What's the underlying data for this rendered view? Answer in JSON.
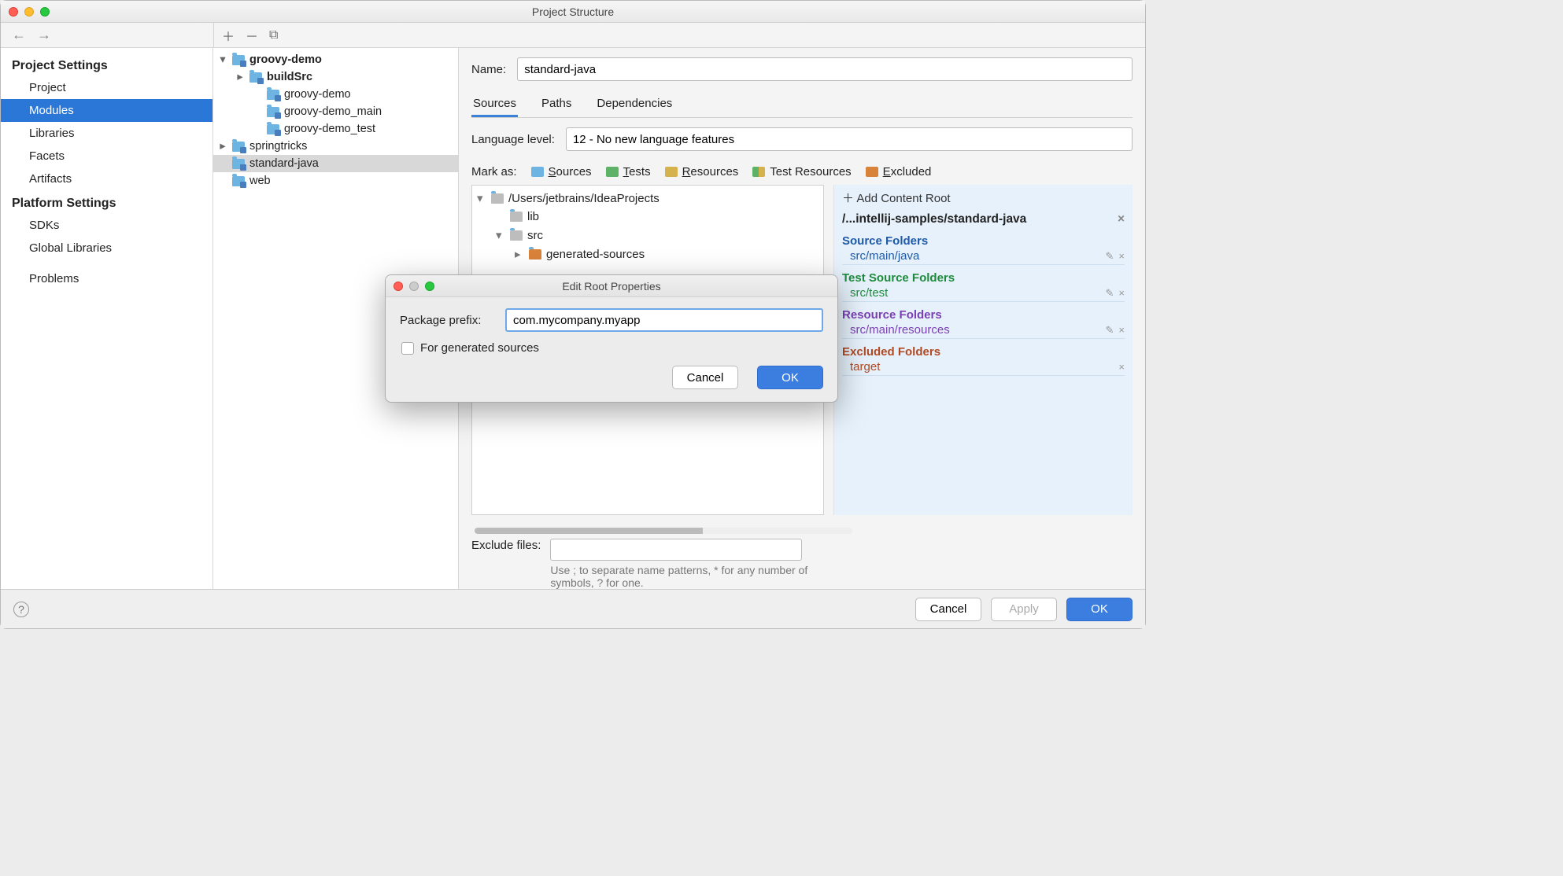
{
  "window": {
    "title": "Project Structure"
  },
  "sidebar": {
    "heading1": "Project Settings",
    "heading2": "Platform Settings",
    "items1": [
      "Project",
      "Modules",
      "Libraries",
      "Facets",
      "Artifacts"
    ],
    "items2": [
      "SDKs",
      "Global Libraries"
    ],
    "problems": "Problems",
    "selected": "Modules"
  },
  "tree": [
    {
      "indent": 0,
      "arrow": "down",
      "bold": true,
      "label": "groovy-demo",
      "mod": true
    },
    {
      "indent": 1,
      "arrow": "right",
      "bold": true,
      "label": "buildSrc",
      "mod": true
    },
    {
      "indent": 2,
      "arrow": "none",
      "bold": false,
      "label": "groovy-demo",
      "mod": true
    },
    {
      "indent": 2,
      "arrow": "none",
      "bold": false,
      "label": "groovy-demo_main",
      "mod": true
    },
    {
      "indent": 2,
      "arrow": "none",
      "bold": false,
      "label": "groovy-demo_test",
      "mod": true
    },
    {
      "indent": 0,
      "arrow": "right",
      "bold": false,
      "label": "springtricks",
      "mod": true
    },
    {
      "indent": 0,
      "arrow": "none",
      "bold": false,
      "label": "standard-java",
      "mod": true,
      "selected": true
    },
    {
      "indent": 0,
      "arrow": "none",
      "bold": false,
      "label": "web",
      "mod": true
    }
  ],
  "detail": {
    "name_label": "Name:",
    "name_value": "standard-java",
    "tabs": [
      "Sources",
      "Paths",
      "Dependencies"
    ],
    "active_tab": "Sources",
    "lang_label": "Language level:",
    "lang_value": "12 - No new language features",
    "markas_label": "Mark as:",
    "mark_chips": [
      {
        "color": "sources",
        "label": "Sources",
        "u": "S"
      },
      {
        "color": "tests",
        "label": "Tests",
        "u": "T"
      },
      {
        "color": "resources",
        "label": "Resources",
        "u": "R"
      },
      {
        "color": "testres",
        "label": "Test Resources"
      },
      {
        "color": "excluded",
        "label": "Excluded",
        "u": "E"
      }
    ],
    "src_tree": [
      {
        "indent": 0,
        "arrow": "down",
        "color": "grey",
        "label": "/Users/jetbrains/IdeaProjects"
      },
      {
        "indent": 1,
        "arrow": "none",
        "color": "grey",
        "label": "lib"
      },
      {
        "indent": 1,
        "arrow": "down",
        "color": "grey",
        "label": "src"
      },
      {
        "indent": 2,
        "arrow": "right",
        "color": "orange",
        "label": "generated-sources"
      }
    ],
    "roots": {
      "add_label": "Add Content Root",
      "root_path": "/...intellij-samples/standard-java",
      "sections": [
        {
          "class": "sources",
          "heading": "Source Folders",
          "items": [
            "src/main/java"
          ],
          "editable": true
        },
        {
          "class": "tests",
          "heading": "Test Source Folders",
          "items": [
            "src/test"
          ],
          "editable": true
        },
        {
          "class": "resources",
          "heading": "Resource Folders",
          "items": [
            "src/main/resources"
          ],
          "editable": true
        },
        {
          "class": "excluded",
          "heading": "Excluded Folders",
          "items": [
            "target"
          ],
          "editable": false
        }
      ]
    },
    "exclude_label": "Exclude files:",
    "exclude_value": "",
    "exclude_hint": "Use ; to separate name patterns, * for any number of symbols, ? for one."
  },
  "footer": {
    "cancel": "Cancel",
    "apply": "Apply",
    "ok": "OK"
  },
  "modal": {
    "title": "Edit Root Properties",
    "prefix_label": "Package prefix:",
    "prefix_value": "com.mycompany.myapp",
    "checkbox_label": "For generated sources",
    "cancel": "Cancel",
    "ok": "OK"
  }
}
